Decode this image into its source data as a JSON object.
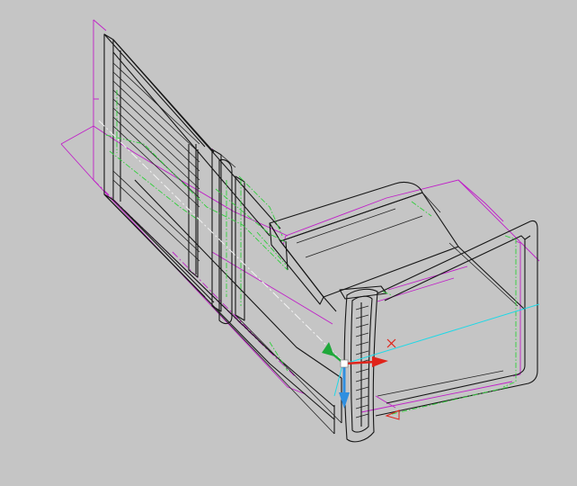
{
  "viewport": {
    "background": "#c5c5c5"
  },
  "colors": {
    "geometry": "#161616",
    "construction": "#c01fc8",
    "centerlines": "#2fcf3a",
    "axis_line": "#20d8e6",
    "gizmo_x": "#e0231a",
    "gizmo_y": "#1fa83a",
    "gizmo_z": "#2f8fe0",
    "pivot_marker": "#e0231a"
  },
  "gizmo": {
    "icon": "move-gizmo-icon",
    "axes": [
      "x-axis-arrow",
      "y-axis-arrow",
      "z-axis-arrow"
    ]
  },
  "pivot_marker": {
    "icon": "x-cross-marker-icon"
  },
  "model": {
    "icon": "wireframe-3d-model-icon"
  }
}
